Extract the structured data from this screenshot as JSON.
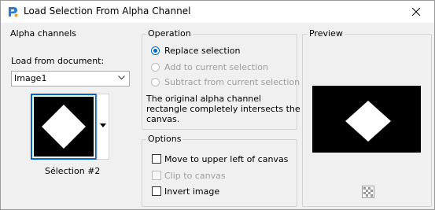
{
  "window": {
    "title": "Load Selection From Alpha Channel"
  },
  "icons": {
    "app": "app-logo-icon",
    "close": "close-icon",
    "preview_tool": "checkerboard-icon"
  },
  "alpha": {
    "legend": "Alpha channels",
    "load_from_label": "Load from document:",
    "document_value": "Image1",
    "selection_name": "Sélection #2"
  },
  "operation": {
    "legend": "Operation",
    "options": [
      {
        "label": "Replace selection",
        "checked": true,
        "enabled": true
      },
      {
        "label": "Add to current selection",
        "checked": false,
        "enabled": false
      },
      {
        "label": "Subtract from current selection",
        "checked": false,
        "enabled": false
      }
    ],
    "message": [
      "The original alpha channel",
      "rectangle completely intersects the",
      "canvas."
    ]
  },
  "options": {
    "legend": "Options",
    "items": [
      {
        "label": "Move to upper left of canvas",
        "checked": false,
        "enabled": true
      },
      {
        "label": "Clip to canvas",
        "checked": false,
        "enabled": false
      },
      {
        "label": "Invert image",
        "checked": false,
        "enabled": true
      }
    ]
  },
  "preview": {
    "legend": "Preview"
  },
  "colors": {
    "accent": "#0067c0",
    "preview_bg": "#000000",
    "shape": "#ffffff"
  }
}
